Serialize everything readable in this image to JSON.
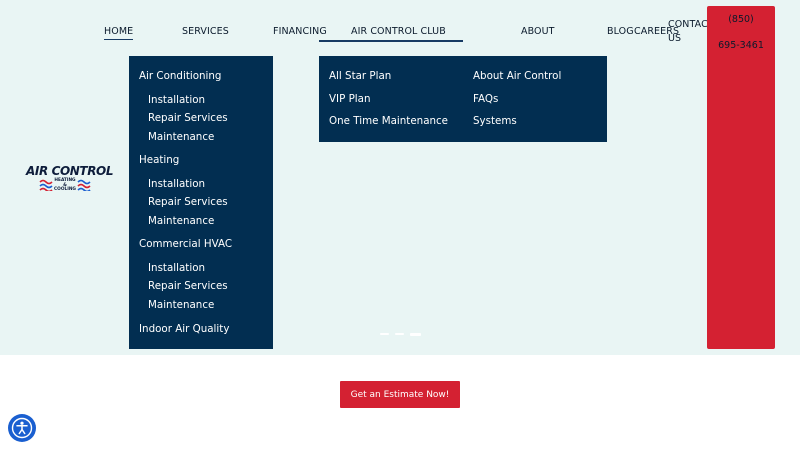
{
  "nav": {
    "home": "HOME",
    "services": "SERVICES",
    "financing": "FINANCING",
    "club": "AIR CONTROL CLUB",
    "about": "ABOUT",
    "blog": "BLOG",
    "careers": "CAREERS",
    "contact_line1": "CONTACT",
    "contact_line2": "US"
  },
  "logo": {
    "title": "AIR CONTROL",
    "sub_line1": "HEATING",
    "sub_line2": "& COOLING"
  },
  "services_menu": {
    "items": [
      {
        "label": "Air Conditioning"
      },
      {
        "label": "Installation"
      },
      {
        "label": "Repair Services"
      },
      {
        "label": "Maintenance"
      },
      {
        "label": "Heating"
      },
      {
        "label": "Installation"
      },
      {
        "label": "Repair Services"
      },
      {
        "label": "Maintenance"
      },
      {
        "label": "Commercial HVAC"
      },
      {
        "label": "Installation"
      },
      {
        "label": "Repair Services"
      },
      {
        "label": "Maintenance"
      },
      {
        "label": "Indoor Air Quality"
      }
    ]
  },
  "club_menu": {
    "left": [
      {
        "label": "All Star Plan"
      },
      {
        "label": "VIP Plan"
      },
      {
        "label": "One Time Maintenance"
      }
    ],
    "right": [
      {
        "label": "About Air Control"
      },
      {
        "label": "FAQs"
      },
      {
        "label": "Systems"
      }
    ]
  },
  "phone": {
    "line1": "(850)",
    "line2": "695-3461"
  },
  "slider": {
    "slide_count": 3,
    "active_index": 2
  },
  "cta": {
    "label": "Get an Estimate Now!"
  },
  "colors": {
    "hero_bg": "#e9f5f4",
    "navy": "#022e51",
    "red": "#d42132",
    "accessibility_blue": "#1a5fd0"
  },
  "icons": {
    "accessibility": "accessibility-icon",
    "logo_flag": "wave-flag-icon"
  }
}
